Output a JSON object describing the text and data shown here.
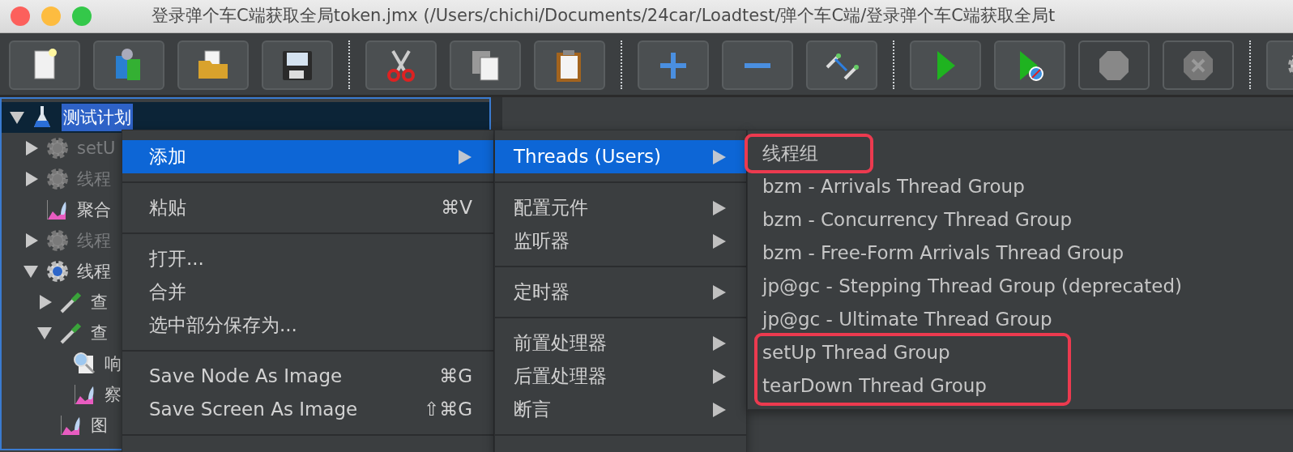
{
  "window": {
    "title": "登录弹个车C端获取全局token.jmx (/Users/chichi/Documents/24car/Loadtest/弹个车C端/登录弹个车C端获取全局t"
  },
  "toolbar": [
    {
      "kind": "new",
      "disabled": false
    },
    {
      "kind": "templates",
      "disabled": false
    },
    {
      "kind": "open",
      "disabled": false
    },
    {
      "kind": "save",
      "disabled": false
    },
    {
      "kind": "separator"
    },
    {
      "kind": "cut",
      "disabled": false
    },
    {
      "kind": "copy",
      "disabled": false
    },
    {
      "kind": "paste",
      "disabled": false
    },
    {
      "kind": "separator"
    },
    {
      "kind": "expand",
      "disabled": false
    },
    {
      "kind": "collapse",
      "disabled": false
    },
    {
      "kind": "toggle",
      "disabled": false
    },
    {
      "kind": "separator"
    },
    {
      "kind": "start",
      "disabled": false
    },
    {
      "kind": "start-no-pause",
      "disabled": false
    },
    {
      "kind": "stop",
      "disabled": true
    },
    {
      "kind": "shutdown",
      "disabled": true
    },
    {
      "kind": "separator"
    },
    {
      "kind": "settings",
      "disabled": false
    }
  ],
  "tree": [
    {
      "label": "测试计划",
      "kind": "test-plan",
      "expanded": true,
      "selected": true,
      "disabled": false,
      "children": [
        {
          "label": "setU",
          "kind": "thread-group",
          "expanded": false,
          "selected": false,
          "disabled": true
        },
        {
          "label": "线程",
          "kind": "thread-group",
          "expanded": false,
          "selected": false,
          "disabled": true
        },
        {
          "label": "聚合",
          "kind": "listener",
          "selected": false,
          "disabled": false
        },
        {
          "label": "线程",
          "kind": "thread-group",
          "expanded": false,
          "selected": false,
          "disabled": true
        },
        {
          "label": "线程",
          "kind": "thread-group",
          "expanded": true,
          "selected": false,
          "disabled": false,
          "children": [
            {
              "label": "查",
              "kind": "sampler",
              "expanded": false,
              "selected": false,
              "disabled": false
            },
            {
              "label": "查",
              "kind": "sampler",
              "expanded": true,
              "selected": false,
              "disabled": false,
              "children": [
                {
                  "label": "响",
                  "kind": "results-tree",
                  "selected": false,
                  "disabled": false
                },
                {
                  "label": "察",
                  "kind": "listener",
                  "selected": false,
                  "disabled": false
                }
              ]
            },
            {
              "label": "图",
              "kind": "listener",
              "selected": false,
              "disabled": false
            }
          ]
        }
      ]
    }
  ],
  "context_menu": {
    "items": [
      {
        "kind": "item",
        "label": "添加",
        "submenu": true,
        "selected": true
      },
      {
        "kind": "separator"
      },
      {
        "kind": "item",
        "label": "粘贴",
        "shortcut": "⌘V",
        "submenu": false,
        "selected": false
      },
      {
        "kind": "separator"
      },
      {
        "kind": "item",
        "label": "打开...",
        "submenu": false,
        "selected": false
      },
      {
        "kind": "item",
        "label": "合并",
        "submenu": false,
        "selected": false
      },
      {
        "kind": "item",
        "label": "选中部分保存为...",
        "submenu": false,
        "selected": false
      },
      {
        "kind": "separator"
      },
      {
        "kind": "item",
        "label": "Save Node As Image",
        "shortcut": "⌘G",
        "submenu": false,
        "selected": false
      },
      {
        "kind": "item",
        "label": "Save Screen As Image",
        "shortcut": "⇧⌘G",
        "submenu": false,
        "selected": false
      },
      {
        "kind": "separator"
      }
    ]
  },
  "add_menu": {
    "items": [
      {
        "kind": "item",
        "label": "Threads (Users)",
        "submenu": true,
        "selected": true
      },
      {
        "kind": "separator"
      },
      {
        "kind": "item",
        "label": "配置元件",
        "submenu": true,
        "selected": false
      },
      {
        "kind": "item",
        "label": "监听器",
        "submenu": true,
        "selected": false
      },
      {
        "kind": "separator"
      },
      {
        "kind": "item",
        "label": "定时器",
        "submenu": true,
        "selected": false
      },
      {
        "kind": "separator"
      },
      {
        "kind": "item",
        "label": "前置处理器",
        "submenu": true,
        "selected": false
      },
      {
        "kind": "item",
        "label": "后置处理器",
        "submenu": true,
        "selected": false
      },
      {
        "kind": "item",
        "label": "断言",
        "submenu": true,
        "selected": false
      },
      {
        "kind": "separator"
      }
    ]
  },
  "threads_menu": {
    "items": [
      {
        "label": "线程组",
        "marked": true
      },
      {
        "label": "bzm - Arrivals Thread Group",
        "marked": false
      },
      {
        "label": "bzm - Concurrency Thread Group",
        "marked": false
      },
      {
        "label": "bzm - Free-Form Arrivals Thread Group",
        "marked": false
      },
      {
        "label": "jp@gc - Stepping Thread Group (deprecated)",
        "marked": false
      },
      {
        "label": "jp@gc - Ultimate Thread Group",
        "marked": false
      },
      {
        "label": "setUp Thread Group",
        "marked": true
      },
      {
        "label": "tearDown Thread Group",
        "marked": true
      }
    ]
  }
}
